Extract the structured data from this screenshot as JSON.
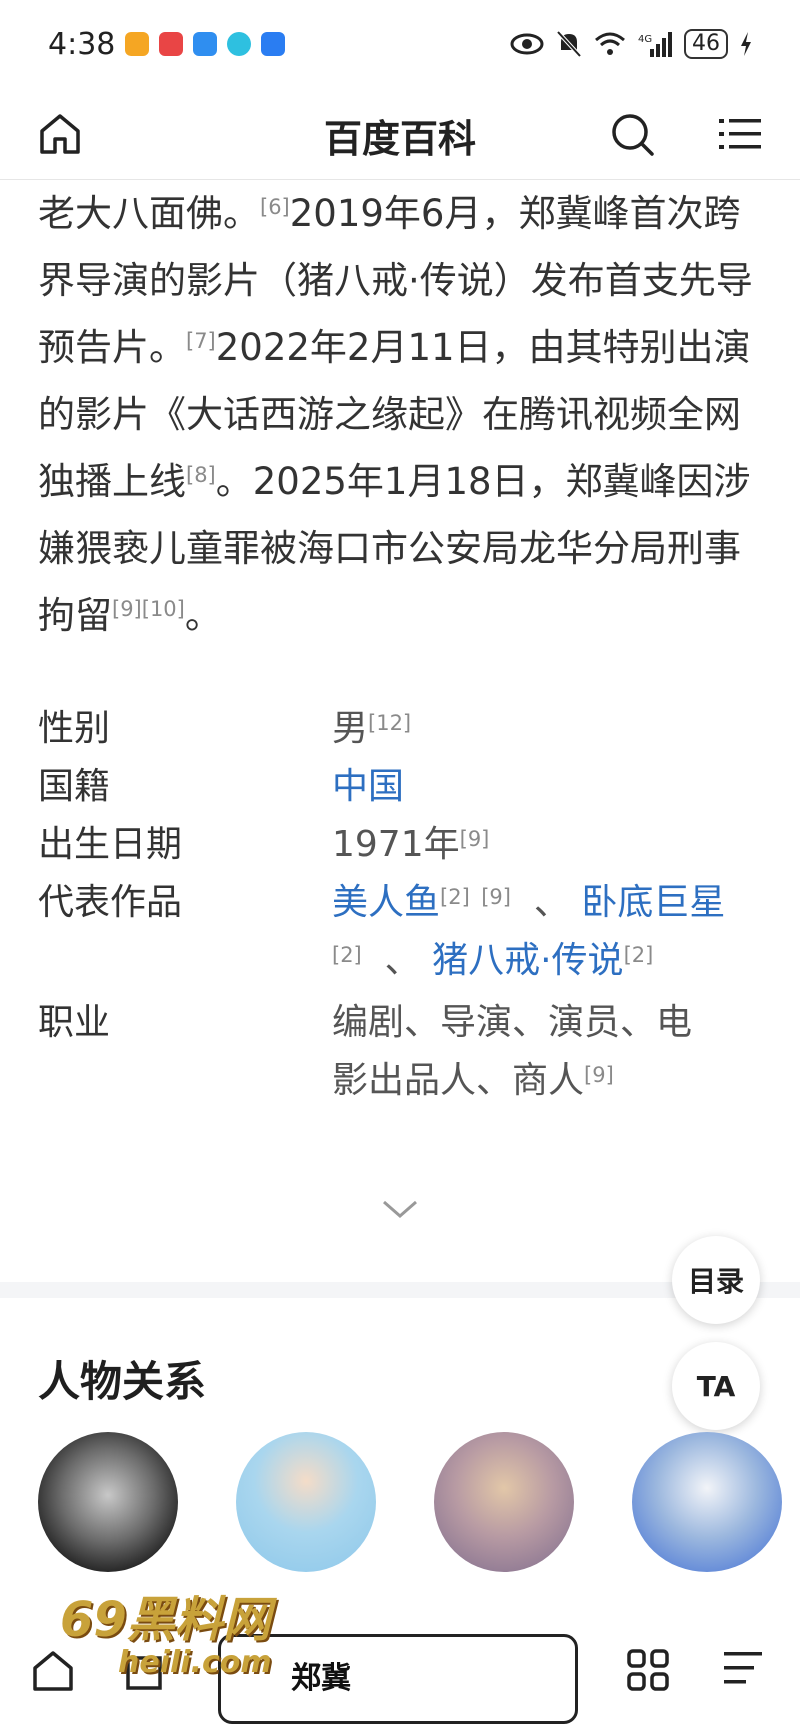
{
  "status": {
    "time": "4:38",
    "battery": "46"
  },
  "nav": {
    "title": "百度百科"
  },
  "bio": {
    "p1": "老大八面佛。",
    "r1": "[6]",
    "p2": "2019年6月，郑冀峰首次跨界导演的影片（猪八戒·传说）发布首支先导预告片。",
    "r2": "[7]",
    "p3": "2022年2月11日，由其特别出演的影片《大话西游之缘起》在腾讯视频全网独播上线",
    "r3": "[8]",
    "p4": "。2025年1月18日，郑冀峰因涉嫌猥亵儿童罪被海口市公安局龙华分局刑事拘留",
    "r4": "[9][10]",
    "p5": "。"
  },
  "info": {
    "gender_label": "性别",
    "gender_value": "男",
    "gender_ref": "[12]",
    "nation_label": "国籍",
    "nation_value": "中国",
    "birth_label": "出生日期",
    "birth_value": "1971年",
    "birth_ref": "[9]",
    "works_label": "代表作品",
    "work1": "美人鱼",
    "work1_ref": "[2]",
    "work1_ref2": "[9]",
    "sep1": "、",
    "work2": "卧底巨星",
    "work2_ref": "[2]",
    "sep2": "、",
    "work3": "猪八戒·传说",
    "work3_ref": "[2]",
    "job_label": "职业",
    "job_value": "编剧、导演、演员、电影出品人、商人",
    "job_ref": "[9]"
  },
  "float": {
    "toc": "目录",
    "ta": "TA"
  },
  "relations": {
    "title": "人物关系"
  },
  "bottom": {
    "search_text": "郑冀"
  },
  "watermark": {
    "main": "69黑料网",
    "sub": "heili.com"
  },
  "colors": {
    "link": "#2d6fc1"
  }
}
